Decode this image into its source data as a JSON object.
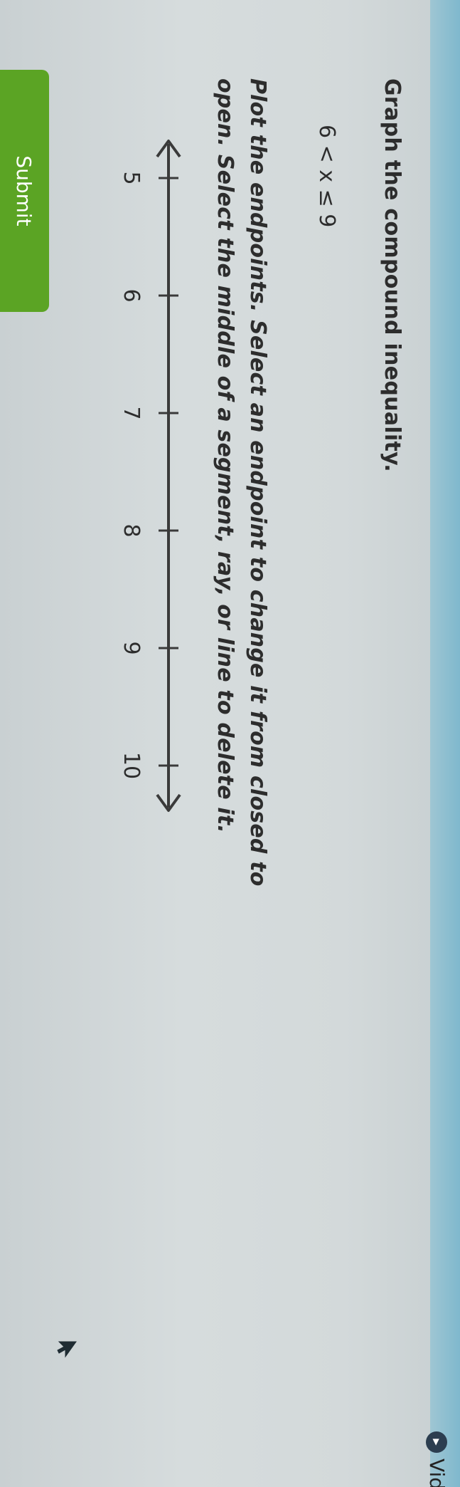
{
  "header": {
    "video_label": "Vide"
  },
  "question": {
    "title": "Graph the compound inequality.",
    "inequality": "6 < x ≤ 9",
    "instructions": "Plot the endpoints. Select an endpoint to change it from closed to open. Select the middle of a segment, ray, or line to delete it."
  },
  "number_line": {
    "ticks": [
      "5",
      "6",
      "7",
      "8",
      "9",
      "10"
    ]
  },
  "actions": {
    "submit_label": "Submit"
  },
  "colors": {
    "submit_bg": "#5ba424",
    "accent_strip": "#7fb8cd"
  },
  "icons": {
    "video": "play-icon",
    "cursor": "mouse-pointer-icon"
  }
}
